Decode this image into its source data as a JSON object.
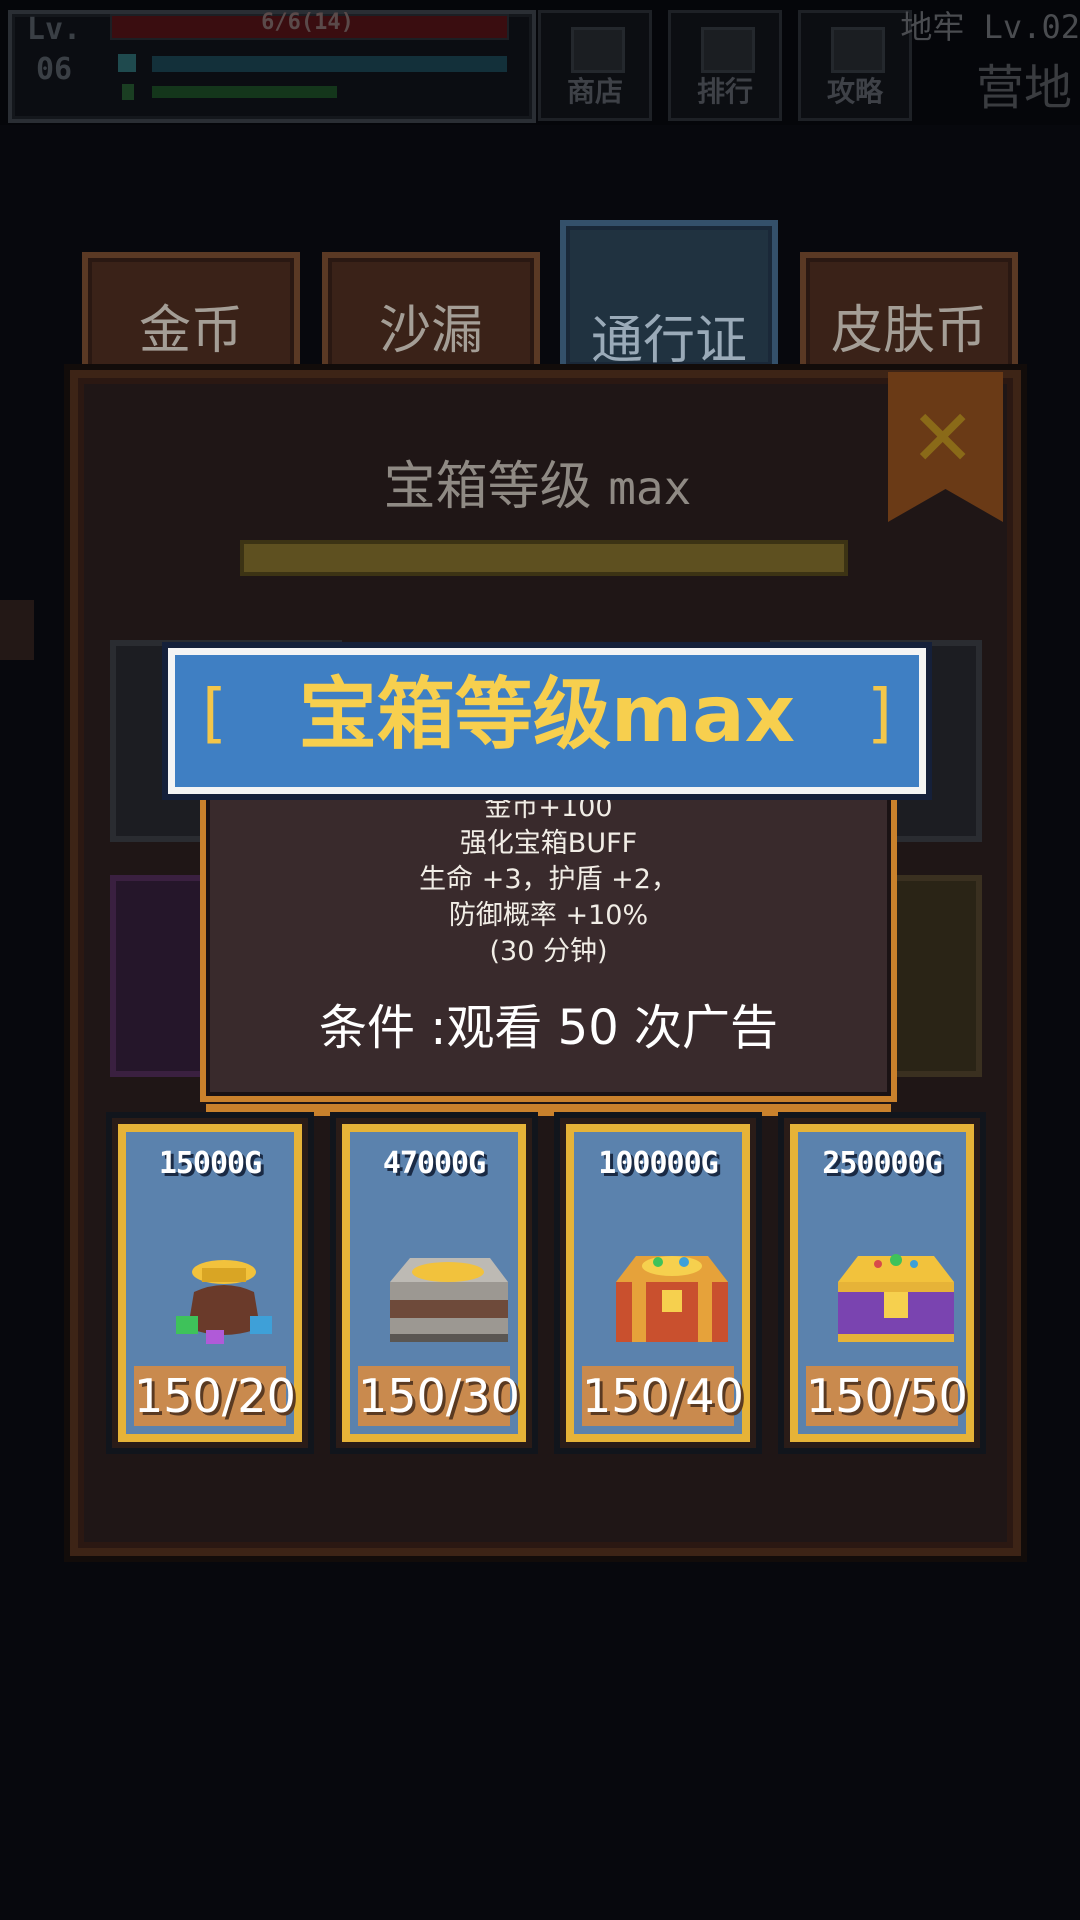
{
  "hud": {
    "level_label": "Lv.",
    "level_value": "06",
    "hp_text": "6/6(14)",
    "shop_label": "商店",
    "rank_label": "排行",
    "guide_label": "攻略",
    "dungeon_label": "地牢 Lv.02",
    "location_label": "营地"
  },
  "tabs": [
    {
      "label": "金币"
    },
    {
      "label": "沙漏"
    },
    {
      "label": "通行证"
    },
    {
      "label": "皮肤币"
    }
  ],
  "panel": {
    "title": "宝箱等级",
    "title_suffix": "max",
    "close_icon": "close-x-icon"
  },
  "popup": {
    "title": "宝箱等级max",
    "lines": [
      "金币+100",
      "强化宝箱BUFF",
      "生命 +3，护盾 +2，",
      "防御概率 +10%",
      "(30 分钟)"
    ],
    "condition": "条件 :观看 50 次广告"
  },
  "cards": [
    {
      "price": "15000G",
      "count": "150/20",
      "icon": "gold-pouch-icon"
    },
    {
      "price": "47000G",
      "count": "150/30",
      "icon": "silver-chest-icon"
    },
    {
      "price": "100000G",
      "count": "150/40",
      "icon": "red-chest-icon"
    },
    {
      "price": "250000G",
      "count": "150/50",
      "icon": "royal-chest-icon"
    }
  ],
  "colors": {
    "ribbon": "#3f7fc3",
    "ribbon_text": "#f7cf4e",
    "card_frame": "#e6b338",
    "card_bg": "#5b82ad",
    "popup_border": "#c9812c"
  }
}
